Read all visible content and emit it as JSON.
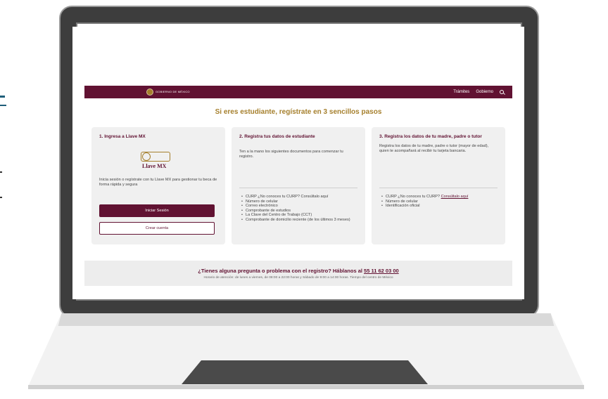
{
  "site": {
    "gob_logo_text": "GOBIERNO DE MÉXICO",
    "nav_links": [
      "Trámites",
      "Gobierno"
    ],
    "search_icon": "search-icon"
  },
  "headline": "Si eres estudiante, regístrate en 3 sencillos pasos",
  "step1": {
    "title": "1. Ingresa a Llave MX",
    "logo_text": "Llave MX",
    "description": "Inicia sesión o regístrate con tu Llave MX para gestionar tu beca de forma rápida y segura",
    "primary_button": "Iniciar Sesión",
    "secondary_button": "Crear cuenta"
  },
  "step2": {
    "title": "2. Registra tus datos de estudiante",
    "description": "Ten a la mano los siguientes documentos para comenzar tu registro.",
    "docs": [
      "CURP ¿No conoces tu CURP? Consúltalo aquí",
      "Número de celular",
      "Correo electrónico",
      "Comprobante de estudios",
      "La Clave del Centro de Trabajo (CCT)",
      "Comprobante de domicilio reciente (de los últimos 3 meses)"
    ]
  },
  "step3": {
    "title": "3. Registra los datos de tu madre, padre o tutor",
    "description": "Registra los datos de tu madre, padre o tutor (mayor de edad), quien te acompañará al recibir tu tarjeta bancaria.",
    "curp_text": "CURP ¿No conoces tu CURP? ",
    "curp_link": "Consúltalo aquí",
    "docs": [
      "Número de celular",
      "Identificación oficial"
    ]
  },
  "contact": {
    "question": "¿Tienes alguna pregunta o problema con el registro? Háblanos al ",
    "phone": "55 11 62 03 00",
    "hours": "Horario de atención: de lunes a viernes, de 08:00 a 22:00 horas y Sábado de 9:00 a 14:00 horas. Tiempo del centro de México"
  },
  "colors": {
    "brand": "#611232",
    "gold": "#a57f2c",
    "card_bg": "#f0f0f0",
    "laptop_frame": "#3d3d3d"
  }
}
